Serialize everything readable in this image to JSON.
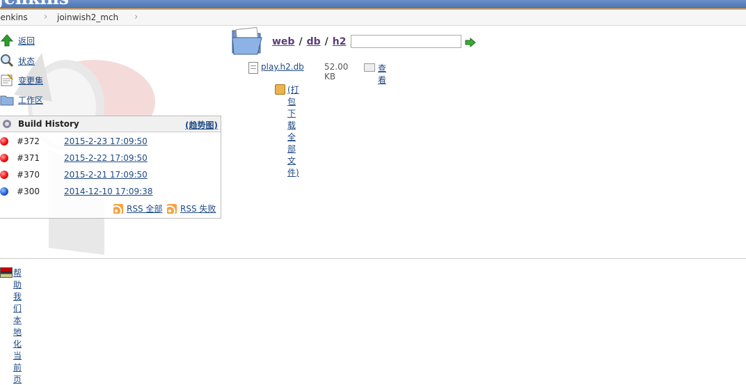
{
  "header": {
    "brand": "Jenkins"
  },
  "breadcrumb": [
    {
      "label": "Jenkins"
    },
    {
      "label": "joinwish2_mch"
    }
  ],
  "tasks": [
    {
      "label": "返回",
      "icon": "up-arrow-icon"
    },
    {
      "label": "状态",
      "icon": "magnifier-icon"
    },
    {
      "label": "变更集",
      "icon": "notepad-icon"
    },
    {
      "label": "工作区",
      "icon": "folder-icon"
    }
  ],
  "build_history": {
    "title": "Build History",
    "trend": "(趋势图)",
    "builds": [
      {
        "number": "#372",
        "date": "2015-2-23 17:09:50",
        "status": "failed",
        "color": "#e11111"
      },
      {
        "number": "#371",
        "date": "2015-2-22 17:09:50",
        "status": "failed",
        "color": "#e11111"
      },
      {
        "number": "#370",
        "date": "2015-2-21 17:09:50",
        "status": "failed",
        "color": "#e11111"
      },
      {
        "number": "#300",
        "date": "2014-12-10 17:09:38",
        "status": "success",
        "color": "#2260d8"
      }
    ],
    "rss_all": "RSS 全部",
    "rss_failed": "RSS 失败"
  },
  "workspace": {
    "path": [
      "web",
      "db",
      "h2"
    ],
    "path_separator": "/",
    "path_input_value": "",
    "file": {
      "name": "play.h2.db",
      "size": "52.00 KB",
      "view": "查看"
    },
    "download_all": "(打包下载全部文件)"
  },
  "footer": {
    "localize": "帮助我们本地化当前页"
  }
}
